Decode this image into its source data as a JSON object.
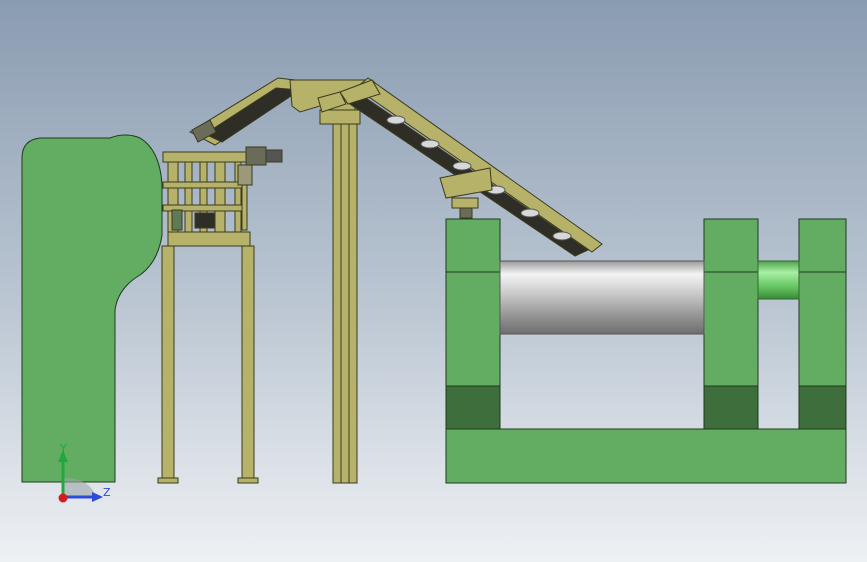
{
  "viewport": {
    "background_top": "#8a9cb1",
    "background_bottom": "#e9edf1"
  },
  "colors": {
    "green_body": "#63ad62",
    "green_dark": "#3d6e3c",
    "green_outline": "#1f3a1f",
    "frame_olive": "#b6b26a",
    "frame_outline": "#3b3a1c",
    "belt_dark": "#2e2e27",
    "roller_light": "#e8e8e8",
    "roller_dark": "#7e7e7e",
    "shaft_green": "#7ed17a"
  },
  "triad": {
    "x_icon": "x-axis-arrow",
    "y_label": "Y",
    "z_label": "Z",
    "y_color": "#22a83a",
    "z_color": "#2b4bd8",
    "origin_color": "#d21d1d"
  }
}
